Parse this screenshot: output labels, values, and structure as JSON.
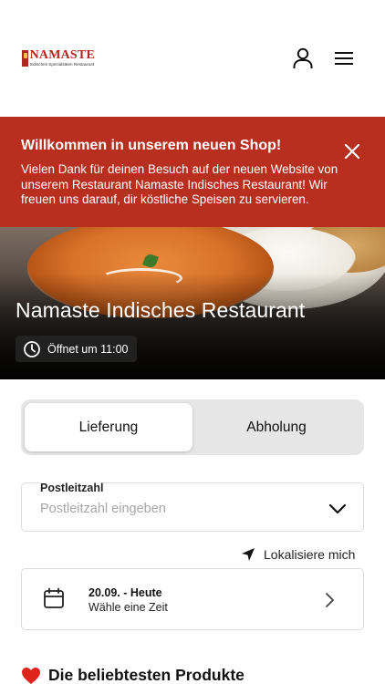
{
  "header": {
    "logo_name": "NAMASTE",
    "logo_sub": "Indisches Spezialitäten Restaurant",
    "icons": {
      "user": "user-icon",
      "menu": "hamburger-menu-icon"
    }
  },
  "banner": {
    "title": "Willkommen in unserem neuen Shop!",
    "text": "Vielen Dank für deinen Besuch auf der neuen Website von unserem Restaurant Namaste Indisches Restaurant! Wir freuen uns darauf, dir köstliche Speisen zu servieren.",
    "background": "#b82e1f"
  },
  "hero": {
    "title": "Namaste Indisches Restaurant",
    "status": "Öffnet um 11:00"
  },
  "order_mode": {
    "options": [
      "Lieferung",
      "Abholung"
    ],
    "selected": "Lieferung"
  },
  "postal": {
    "label": "Postleitzahl",
    "placeholder": "Postleitzahl eingeben",
    "value": ""
  },
  "locate": {
    "label": "Lokalisiere mich"
  },
  "date": {
    "title": "20.09. - Heute",
    "subtitle": "Wähle eine Zeit"
  },
  "popular": {
    "title": "Die beliebtesten Produkte",
    "emoji": "❤️"
  }
}
